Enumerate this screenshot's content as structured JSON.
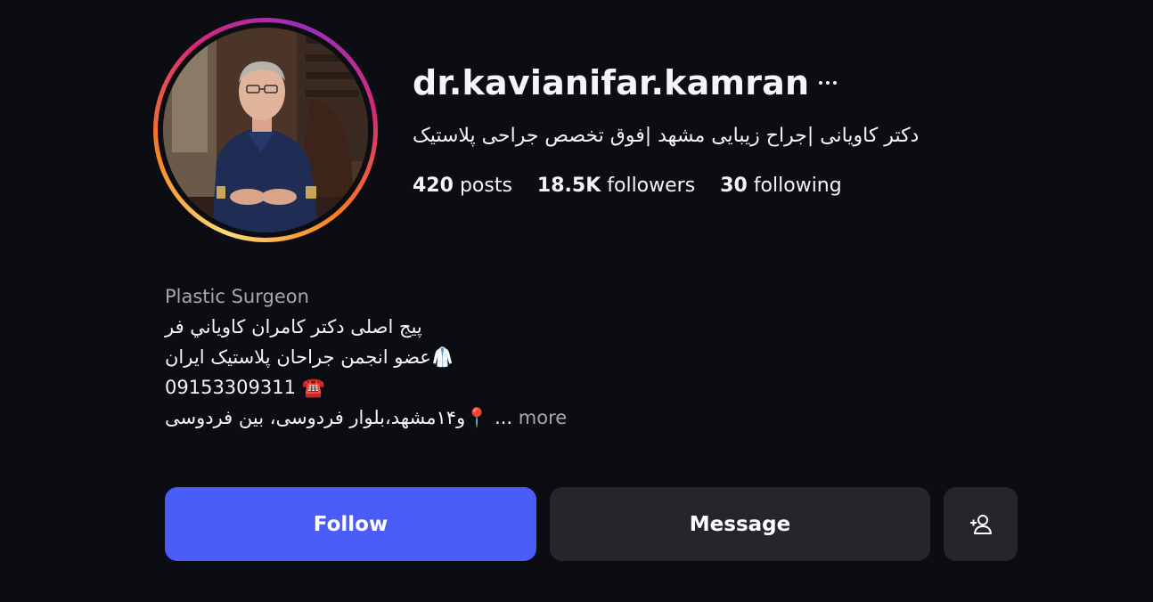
{
  "profile": {
    "username": "dr.kavianifar.kamran",
    "full_name": "دکتر کاویانی |جراح زیبایی مشهد |فوق تخصص جراحی پلاستیک",
    "stats": {
      "posts_count": "420",
      "posts_label": "posts",
      "followers_count": "18.5K",
      "followers_label": "followers",
      "following_count": "30",
      "following_label": "following"
    }
  },
  "bio": {
    "category": "Plastic Surgeon",
    "line1": "پیج اصلی دکتر کامران كاوياني فر",
    "line2_icon": "🥼",
    "line2": "عضو انجمن جراحان پلاستیک ایران",
    "line3": "09153309311",
    "line3_icon": "☎️",
    "line4": "و۱۴مشهد،بلوار فردوسی، بین فردوسی",
    "line4_icon": "📍",
    "ellipsis": "...",
    "more_label": "more"
  },
  "actions": {
    "follow_label": "Follow",
    "message_label": "Message"
  },
  "colors": {
    "background": "#0c0d12",
    "follow_button": "#4a5df9",
    "secondary_button": "#25262b",
    "muted_text": "#a8a8a8"
  },
  "icons": {
    "more": "more-horizontal-icon",
    "add_user": "add-user-icon"
  }
}
